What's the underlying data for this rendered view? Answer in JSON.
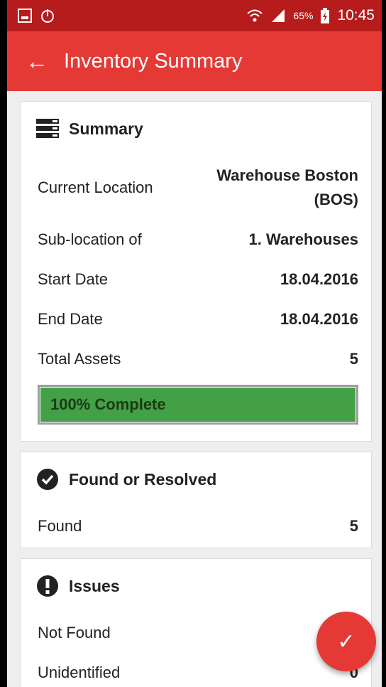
{
  "status_bar": {
    "battery": "65%",
    "time": "10:45"
  },
  "app_bar": {
    "title": "Inventory Summary"
  },
  "summary": {
    "title": "Summary",
    "rows": [
      {
        "label": "Current Location",
        "value": "Warehouse Boston (BOS)"
      },
      {
        "label": "Sub-location of",
        "value": "1. Warehouses"
      },
      {
        "label": "Start Date",
        "value": "18.04.2016"
      },
      {
        "label": "End Date",
        "value": "18.04.2016"
      },
      {
        "label": "Total Assets",
        "value": "5"
      }
    ],
    "progress": {
      "label": "100% Complete",
      "percent": 100,
      "color": "#43a047"
    }
  },
  "found": {
    "title": "Found or Resolved",
    "rows": [
      {
        "label": "Found",
        "value": "5"
      }
    ]
  },
  "issues": {
    "title": "Issues",
    "rows": [
      {
        "label": "Not Found",
        "value": ""
      },
      {
        "label": "Unidentified",
        "value": "0"
      }
    ]
  },
  "colors": {
    "primary": "#e53935",
    "status_bar": "#b71c1c"
  },
  "icons": {
    "fab": "check-icon"
  }
}
